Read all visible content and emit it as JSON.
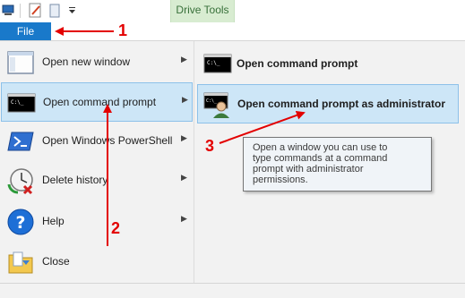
{
  "ribbon": {
    "context_tab": "Drive Tools",
    "file_tab": "File"
  },
  "menu": {
    "items": [
      {
        "label": "Open new window",
        "icon": "window-icon",
        "has_submenu": true
      },
      {
        "label": "Open command prompt",
        "icon": "command-prompt-icon",
        "has_submenu": true,
        "highlighted": true
      },
      {
        "label": "Open Windows PowerShell",
        "icon": "powershell-icon",
        "has_submenu": true
      },
      {
        "label": "Delete history",
        "icon": "delete-history-icon",
        "has_submenu": true
      },
      {
        "label": "Help",
        "icon": "help-icon",
        "has_submenu": true
      },
      {
        "label": "Close",
        "icon": "close-folder-icon",
        "has_submenu": false
      }
    ]
  },
  "submenu": {
    "items": [
      {
        "label": "Open command prompt",
        "icon": "command-prompt-icon"
      },
      {
        "label": "Open command prompt as administrator",
        "icon": "admin-command-prompt-icon",
        "highlighted": true
      }
    ]
  },
  "tooltip": {
    "text_lines": [
      "Open a window you can use to",
      "type commands at a command",
      "prompt with administrator",
      "permissions."
    ]
  },
  "annotations": {
    "step1": "1",
    "step2": "2",
    "step3": "3",
    "color": "#e30000"
  },
  "colors": {
    "file_tab": "#1979ca",
    "context_tab": "#d8ecd1",
    "highlight": "#cde6f7",
    "highlight_border": "#8dc1e9",
    "menu_bg": "#f2f2f2"
  }
}
